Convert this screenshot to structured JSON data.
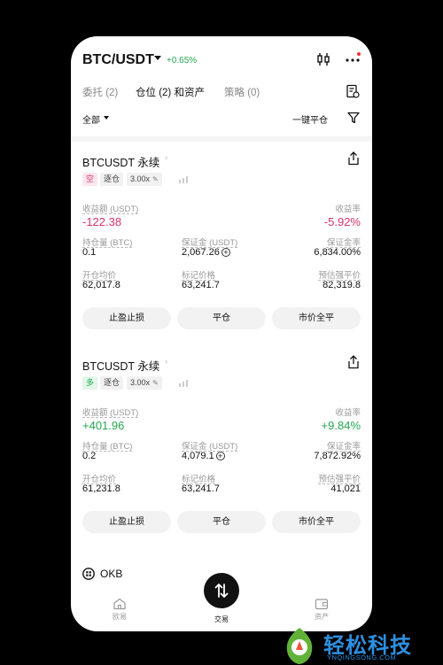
{
  "header": {
    "pair": "BTC/USDT",
    "change": "+0.65%",
    "colors": {
      "up": "#25a750",
      "down": "#d6336c"
    }
  },
  "tabs": [
    {
      "label": "委托 (2)"
    },
    {
      "label": "仓位 (2) 和资产"
    },
    {
      "label": "策略 (0)"
    }
  ],
  "filter": {
    "all_label": "全部",
    "close_all_label": "一键平仓"
  },
  "positions": [
    {
      "title": "BTCUSDT 永续",
      "side": "空",
      "margin_mode": "逐仓",
      "leverage": "3.00x",
      "pnl_label": "收益额 (USDT)",
      "pnl": "-122.38",
      "roe_label": "收益率",
      "roe": "-5.92%",
      "size_label": "持仓量 (BTC)",
      "size": "0.1",
      "margin_label": "保证金 (USDT)",
      "margin": "2,067.26",
      "margin_ratio_label": "保证金率",
      "margin_ratio": "6,834.00%",
      "entry_label": "开仓均价",
      "entry": "62,017.8",
      "mark_label": "标记价格",
      "mark": "63,241.7",
      "liq_label": "预估强平价",
      "liq": "82,319.8",
      "buttons": [
        "止盈止损",
        "平仓",
        "市价全平"
      ]
    },
    {
      "title": "BTCUSDT 永续",
      "side": "多",
      "margin_mode": "逐仓",
      "leverage": "3.00x",
      "pnl_label": "收益额 (USDT)",
      "pnl": "+401.96",
      "roe_label": "收益率",
      "roe": "+9.84%",
      "size_label": "持仓量 (BTC)",
      "size": "0.2",
      "margin_label": "保证金 (USDT)",
      "margin": "4,079.1",
      "margin_ratio_label": "保证金率",
      "margin_ratio": "7,872.92%",
      "entry_label": "开仓均价",
      "entry": "61,231.8",
      "mark_label": "标记价格",
      "mark": "63,241.7",
      "liq_label": "预估强平价",
      "liq": "41,021",
      "buttons": [
        "止盈止损",
        "平仓",
        "市价全平"
      ]
    }
  ],
  "asset": {
    "label": "OKB"
  },
  "nav": {
    "home": "欧易",
    "trade": "交易",
    "assets": "资产"
  },
  "watermark": {
    "text": "轻松科技",
    "url": "YNQINGSONG.COM"
  }
}
